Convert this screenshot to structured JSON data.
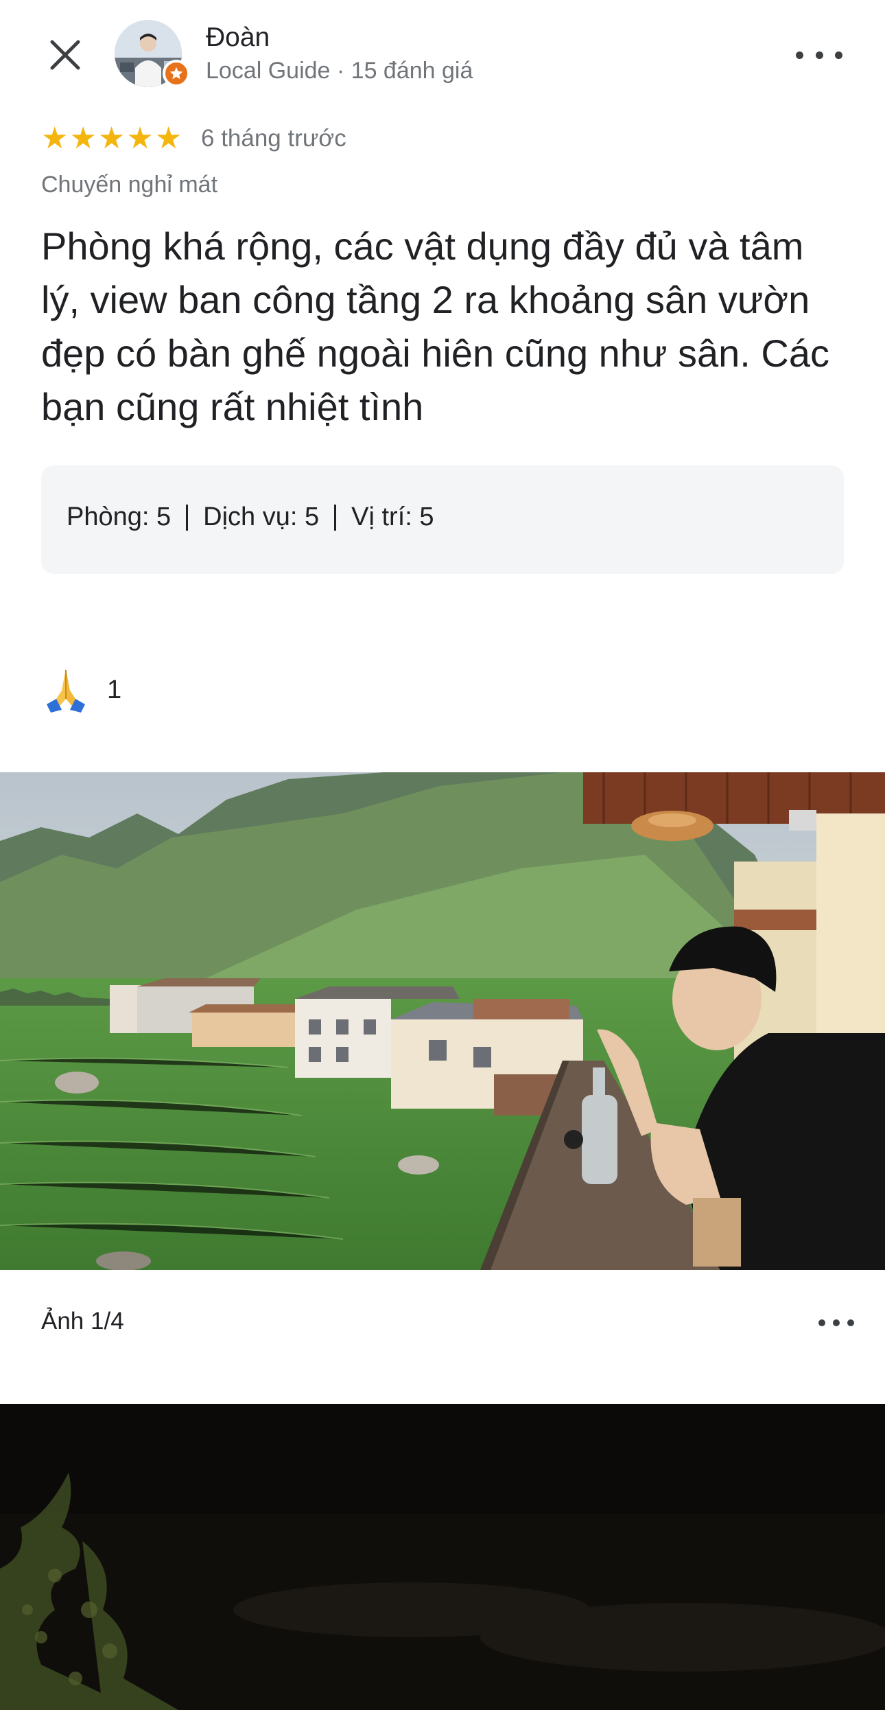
{
  "header": {
    "reviewer_name": "Đoàn",
    "reviewer_sub": "Local Guide · 15 đánh giá"
  },
  "review": {
    "stars": 5,
    "time_ago": "6 tháng trước",
    "trip_type": "Chuyến nghỉ mát",
    "text": "Phòng khá rộng, các vật dụng đầy đủ và tâm lý, view ban công tầng 2 ra khoảng sân vườn đẹp có bàn ghế ngoài hiên cũng như sân. Các bạn cũng rất nhiệt tình",
    "ratings": [
      {
        "label": "Phòng:",
        "value": "5"
      },
      {
        "label": "Dịch vụ:",
        "value": "5"
      },
      {
        "label": "Vị trí:",
        "value": "5"
      }
    ]
  },
  "reaction": {
    "emoji": "🙏",
    "count": "1"
  },
  "photos": {
    "counter": "Ảnh 1/4"
  },
  "colors": {
    "star": "#f5b50f",
    "badge": "#e8711c",
    "ratings_bg": "#f4f5f7",
    "secondary_text": "#70757a"
  },
  "icons": [
    "close-icon",
    "more-vert-icon",
    "star-icon",
    "local-guide-badge-icon",
    "pray-hands-icon"
  ]
}
